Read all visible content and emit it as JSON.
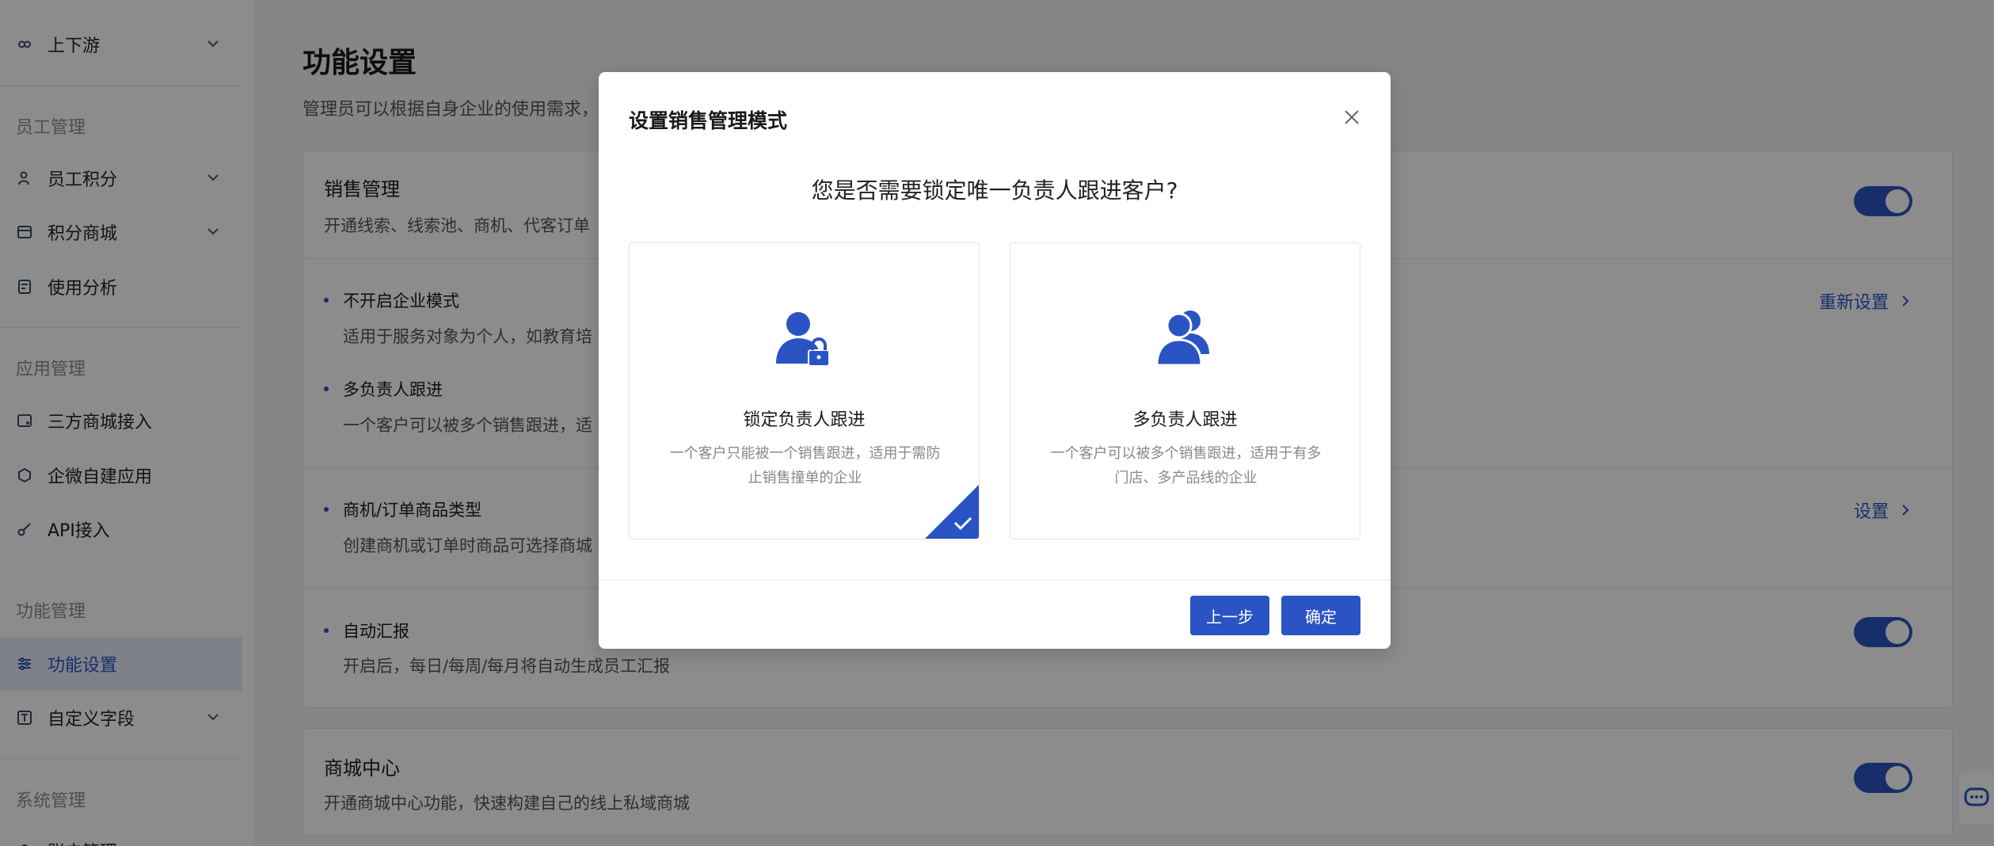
{
  "sidebar": {
    "top_item": {
      "label": "上下游",
      "icon": "link-icon"
    },
    "sections": [
      {
        "label": "员工管理"
      },
      {
        "label": "应用管理"
      },
      {
        "label": "功能管理"
      },
      {
        "label": "系统管理"
      }
    ],
    "items": [
      {
        "label": "员工积分",
        "icon": "user-points-icon",
        "expandable": true
      },
      {
        "label": "积分商城",
        "icon": "store-icon",
        "expandable": true
      },
      {
        "label": "使用分析",
        "icon": "analytics-icon",
        "expandable": false
      },
      {
        "label": "三方商城接入",
        "icon": "third-party-icon",
        "expandable": false
      },
      {
        "label": "企微自建应用",
        "icon": "app-icon",
        "expandable": false
      },
      {
        "label": "API接入",
        "icon": "key-icon",
        "expandable": false
      },
      {
        "label": "功能设置",
        "icon": "sliders-icon",
        "expandable": false,
        "active": true
      },
      {
        "label": "自定义字段",
        "icon": "text-field-icon",
        "expandable": true
      },
      {
        "label": "账户管理",
        "icon": "account-icon",
        "expandable": false
      }
    ]
  },
  "main": {
    "title": "功能设置",
    "desc": "管理员可以根据自身企业的使用需求，",
    "sales_card": {
      "title": "销售管理",
      "desc": "开通线索、线索池、商机、代客订单",
      "toggle_on": true,
      "items": [
        {
          "title": "不开启企业模式",
          "desc": "适用于服务对象为个人，如教育培",
          "link": "重新设置"
        },
        {
          "title": "多负责人跟进",
          "desc": "一个客户可以被多个销售跟进，适"
        },
        {
          "title": "商机/订单商品类型",
          "desc": "创建商机或订单时商品可选择商城",
          "link": "设置"
        },
        {
          "title": "自动汇报",
          "desc": "开启后，每日/每周/每月将自动生成员工汇报",
          "toggle_on": true
        }
      ]
    },
    "mall_card": {
      "title": "商城中心",
      "desc": "开通商城中心功能，快速构建自己的线上私域商城",
      "toggle_on": true
    }
  },
  "modal": {
    "title": "设置销售管理模式",
    "question": "您是否需要锁定唯一负责人跟进客户?",
    "options": [
      {
        "title": "锁定负责人跟进",
        "desc": "一个客户只能被一个销售跟进，适用于需防止销售撞单的企业",
        "icon": "user-lock-icon",
        "selected": true
      },
      {
        "title": "多负责人跟进",
        "desc": "一个客户可以被多个销售跟进，适用于有多门店、多产品线的企业",
        "icon": "users-icon",
        "selected": false
      }
    ],
    "prev_label": "上一步",
    "ok_label": "确定"
  },
  "colors": {
    "primary": "#2a54c4",
    "overlay": "rgba(0,0,0,0.45)"
  }
}
